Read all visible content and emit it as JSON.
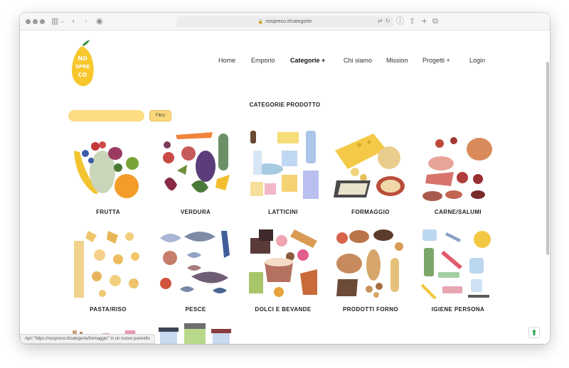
{
  "browser": {
    "url": "nospreco.it/categorie",
    "icons": [
      "sidebar-icon",
      "back-icon",
      "forward-icon",
      "shield-icon",
      "lock-icon",
      "translate-icon",
      "reload-icon",
      "download-icon",
      "share-icon",
      "new-tab-icon",
      "tabs-icon"
    ],
    "status_text": "Apri \"https://nospreco.it/categorie/formaggio\" in un nuovo pannello"
  },
  "logo": {
    "text_lines": [
      "NO",
      "SPRE",
      "CO"
    ]
  },
  "nav": {
    "items": [
      {
        "label": "Home"
      },
      {
        "label": "Emporio"
      },
      {
        "label": "Categorie",
        "suffix": "+",
        "active": true
      },
      {
        "label": "Chi siamo"
      },
      {
        "label": "Mission"
      },
      {
        "label": "Progetti",
        "suffix": "+"
      },
      {
        "label": "Login"
      }
    ]
  },
  "section": {
    "title": "CATEGORIE PRODOTTO"
  },
  "filter": {
    "input_value": "",
    "placeholder": "",
    "button_label": "Filtro"
  },
  "categories": [
    {
      "label": "FRUTTA"
    },
    {
      "label": "VERDURA"
    },
    {
      "label": "LATTICINI"
    },
    {
      "label": "FORMAGGIO"
    },
    {
      "label": "CARNE/SALUMI"
    },
    {
      "label": "PASTA/RISO"
    },
    {
      "label": "PESCE"
    },
    {
      "label": "DOLCI E BEVANDE"
    },
    {
      "label": "PRODOTTI FORNO"
    },
    {
      "label": "IGIENE PERSONA"
    }
  ],
  "colors": {
    "accent": "#fddc84",
    "button": "#fcd67a",
    "logo_yellow": "#f7c72c",
    "logo_leaf": "#3d8a3a",
    "scroll_top": "#2aa04a"
  }
}
